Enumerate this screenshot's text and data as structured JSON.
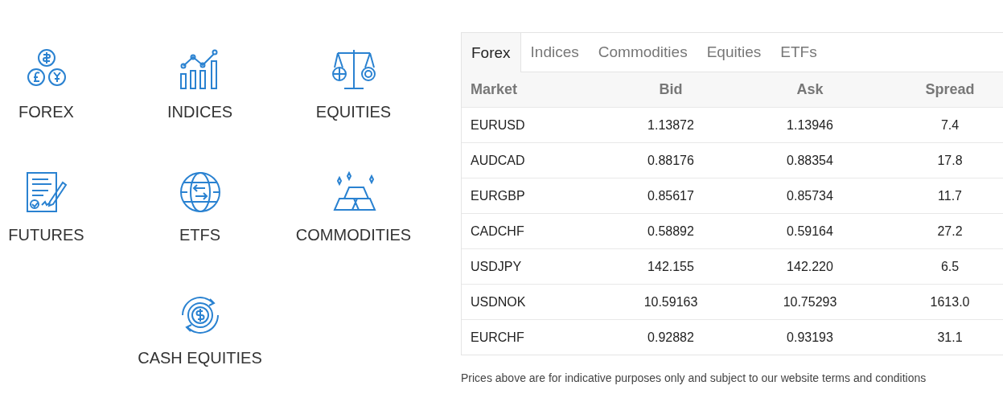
{
  "products": [
    {
      "label": "FOREX"
    },
    {
      "label": "INDICES"
    },
    {
      "label": "EQUITIES"
    },
    {
      "label": "FUTURES"
    },
    {
      "label": "ETFS"
    },
    {
      "label": "COMMODITIES"
    },
    {
      "label": "CASH EQUITIES"
    }
  ],
  "tabs": [
    {
      "label": "Forex",
      "selected": true
    },
    {
      "label": "Indices",
      "selected": false
    },
    {
      "label": "Commodities",
      "selected": false
    },
    {
      "label": "Equities",
      "selected": false
    },
    {
      "label": "ETFs",
      "selected": false
    }
  ],
  "table": {
    "columns": [
      "Market",
      "Bid",
      "Ask",
      "Spread"
    ],
    "rows": [
      [
        "EURUSD",
        "1.13872",
        "1.13946",
        "7.4"
      ],
      [
        "AUDCAD",
        "0.88176",
        "0.88354",
        "17.8"
      ],
      [
        "EURGBP",
        "0.85617",
        "0.85734",
        "11.7"
      ],
      [
        "CADCHF",
        "0.58892",
        "0.59164",
        "27.2"
      ],
      [
        "USDJPY",
        "142.155",
        "142.220",
        "6.5"
      ],
      [
        "USDNOK",
        "10.59163",
        "10.75293",
        "1613.0"
      ],
      [
        "EURCHF",
        "0.92882",
        "0.93193",
        "31.1"
      ]
    ]
  },
  "disclaimer": "Prices above are for indicative purposes only and subject to our website terms and conditions"
}
